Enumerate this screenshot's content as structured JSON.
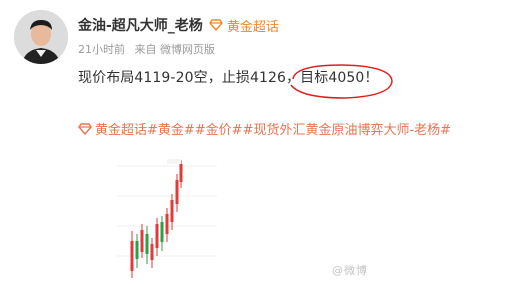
{
  "post": {
    "author_name": "金油-超凡大师_老杨",
    "topic_label": "黄金超话",
    "time": "21小时前",
    "source": "来自 微博网页版",
    "content": "现价布局4119-20空，止损4126，目标4050！",
    "hashtags": "黄金超话#黄金##金价##现货外汇黄金原油博弈大师-老杨#",
    "watermark": "@微博 ⁠ ⁠ ⁠ ⁠ ⁠ ⁠"
  },
  "colors": {
    "accent": "#f18922",
    "hashtag": "#eb7350",
    "annotation": "#e02020",
    "candle_up": "#e03a3a",
    "candle_down": "#2aa04a"
  },
  "icons": {
    "topic": "diamond-icon",
    "hashtag": "diamond-icon"
  }
}
